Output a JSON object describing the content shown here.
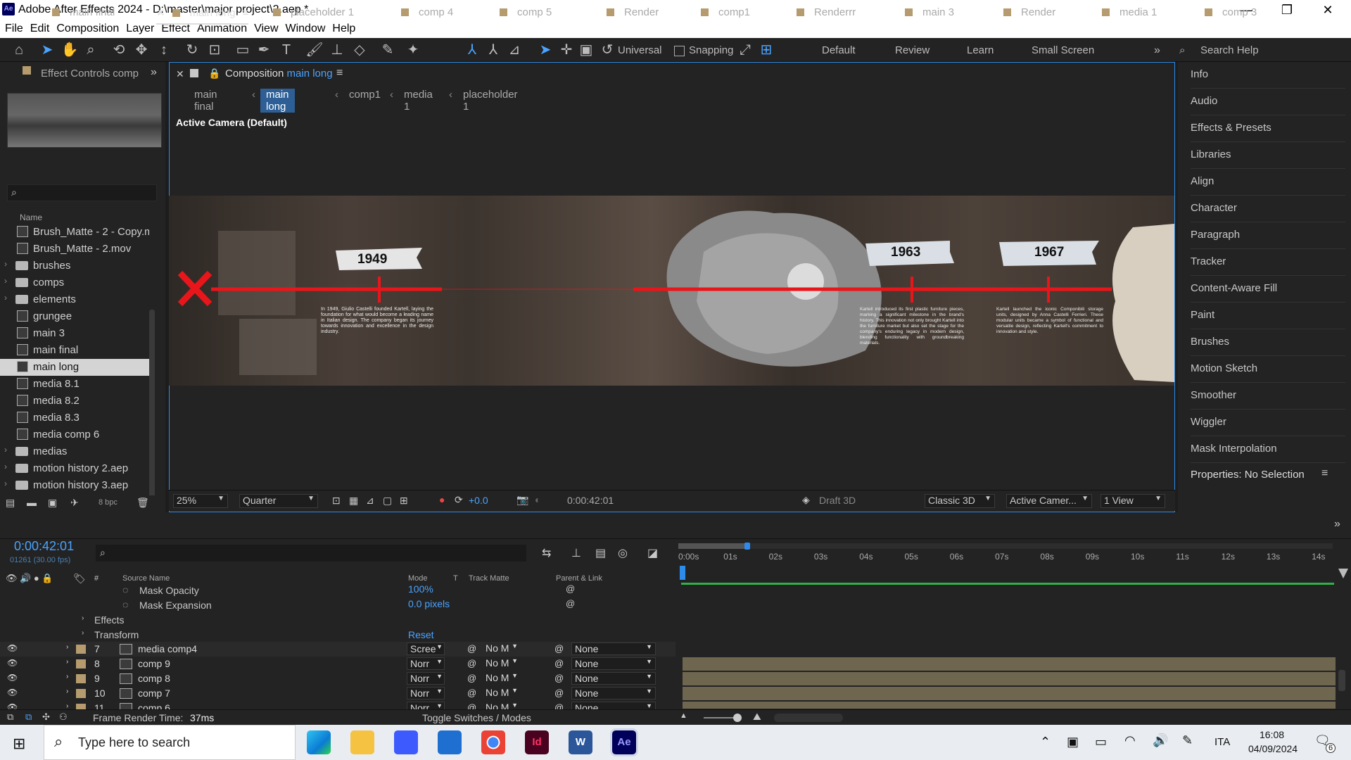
{
  "app": {
    "title": "Adobe After Effects 2024 - D:\\master\\major project\\2.aep *",
    "logo": "Ae",
    "window_controls": [
      "—",
      "❐",
      "✕"
    ]
  },
  "menu": [
    "File",
    "Edit",
    "Composition",
    "Layer",
    "Effect",
    "Animation",
    "View",
    "Window",
    "Help"
  ],
  "toolbar": {
    "universal": "Universal",
    "snapping": "Snapping",
    "workspaces": [
      "Default",
      "Review",
      "Learn",
      "Small Screen"
    ],
    "search": "Search Help"
  },
  "effect_controls": {
    "title": "Effect Controls comp"
  },
  "project": {
    "name_header": "Name",
    "bpc": "8 bpc",
    "items": [
      {
        "label": "Brush_Matte - 2 - Copy.mov",
        "type": "file",
        "selected": false,
        "expand": false
      },
      {
        "label": "Brush_Matte - 2.mov",
        "type": "file",
        "selected": false,
        "expand": false
      },
      {
        "label": "brushes",
        "type": "folder",
        "selected": false,
        "expand": true
      },
      {
        "label": "comps",
        "type": "folder",
        "selected": false,
        "expand": true
      },
      {
        "label": "elements",
        "type": "folder",
        "selected": false,
        "expand": true
      },
      {
        "label": "grungee",
        "type": "comp",
        "selected": false,
        "expand": false
      },
      {
        "label": "main 3",
        "type": "comp",
        "selected": false,
        "expand": false
      },
      {
        "label": "main final",
        "type": "comp",
        "selected": false,
        "expand": false
      },
      {
        "label": "main long",
        "type": "comp",
        "selected": true,
        "expand": false
      },
      {
        "label": "media 8.1",
        "type": "comp",
        "selected": false,
        "expand": false
      },
      {
        "label": "media 8.2",
        "type": "comp",
        "selected": false,
        "expand": false
      },
      {
        "label": "media 8.3",
        "type": "comp",
        "selected": false,
        "expand": false
      },
      {
        "label": "media comp 6",
        "type": "comp",
        "selected": false,
        "expand": false
      },
      {
        "label": "medias",
        "type": "folder",
        "selected": false,
        "expand": true
      },
      {
        "label": "motion history 2.aep",
        "type": "folder",
        "selected": false,
        "expand": true
      },
      {
        "label": "motion history 3.aep",
        "type": "folder",
        "selected": false,
        "expand": true
      }
    ]
  },
  "composition": {
    "tab_prefix": "Composition",
    "tab_name": "main long",
    "breadcrumbs": [
      "main final",
      "main long",
      "comp1",
      "media 1",
      "placeholder 1"
    ],
    "camera": "Active Camera (Default)",
    "footer": {
      "zoom": "25%",
      "resolution": "Quarter",
      "exposure": "+0.0",
      "time": "0:00:42:01",
      "draft": "Draft 3D",
      "renderer": "Classic 3D",
      "camera": "Active Camer...",
      "views": "1 View"
    }
  },
  "canvas": {
    "years": [
      "1949",
      "1963",
      "1967"
    ],
    "texts": [
      "In 1949, Giulio Castelli founded Kartell, laying the foundation for what would become a leading name in Italian design. The company began its journey towards innovation and excellence in the design industry.",
      "Kartell introduced its first plastic furniture pieces, marking a significant milestone in the brand's history. This innovation not only brought Kartell into the furniture market but also set the stage for the company's enduring legacy in modern design, blending functionality with groundbreaking materials.",
      "Kartell launched the iconic Componibili storage units, designed by Anna Castelli Ferrieri. These modular units became a symbol of functional and versatile design, reflecting Kartell's commitment to innovation and style."
    ]
  },
  "right_panel": {
    "items": [
      "Info",
      "Audio",
      "Effects & Presets",
      "Libraries",
      "Align",
      "Character",
      "Paragraph",
      "Tracker",
      "Content-Aware Fill",
      "Paint",
      "Brushes",
      "Motion Sketch",
      "Smoother",
      "Wiggler",
      "Mask Interpolation"
    ],
    "properties": "Properties: No Selection"
  },
  "timeline_tabs": [
    "main final",
    "main long",
    "placeholder 1",
    "comp 4",
    "comp 5",
    "Render",
    "comp1",
    "Renderrr",
    "main 3",
    "Render",
    "media 1",
    "comp 3"
  ],
  "timeline": {
    "time": "0:00:42:01",
    "fps": "01261 (30.00 fps)",
    "headers": {
      "source": "Source Name",
      "mode": "Mode",
      "t": "T",
      "track": "Track Matte",
      "parent": "Parent & Link"
    },
    "props": [
      {
        "name": "Mask Opacity",
        "value": "100%"
      },
      {
        "name": "Mask Expansion",
        "value": "0.0 pixels"
      }
    ],
    "groups": [
      "Effects",
      "Transform"
    ],
    "reset": "Reset",
    "layers": [
      {
        "num": "7",
        "name": "media comp4",
        "mode": "Scree",
        "matte": "No M",
        "parent": "None"
      },
      {
        "num": "8",
        "name": "comp 9",
        "mode": "Norr",
        "matte": "No M",
        "parent": "None"
      },
      {
        "num": "9",
        "name": "comp 8",
        "mode": "Norr",
        "matte": "No M",
        "parent": "None"
      },
      {
        "num": "10",
        "name": "comp 7",
        "mode": "Norr",
        "matte": "No M",
        "parent": "None"
      },
      {
        "num": "11",
        "name": "comp 6",
        "mode": "Norr",
        "matte": "No M",
        "parent": "None"
      }
    ],
    "ruler": [
      "0:00s",
      "01s",
      "02s",
      "03s",
      "04s",
      "05s",
      "06s",
      "07s",
      "08s",
      "09s",
      "10s",
      "11s",
      "12s",
      "13s",
      "14s"
    ]
  },
  "status": {
    "render_label": "Frame Render Time:",
    "render_value": "37ms",
    "toggle": "Toggle Switches / Modes"
  },
  "taskbar": {
    "search": "Type here to search",
    "lang": "ITA",
    "time": "16:08",
    "date": "04/09/2024",
    "badge": "6"
  }
}
